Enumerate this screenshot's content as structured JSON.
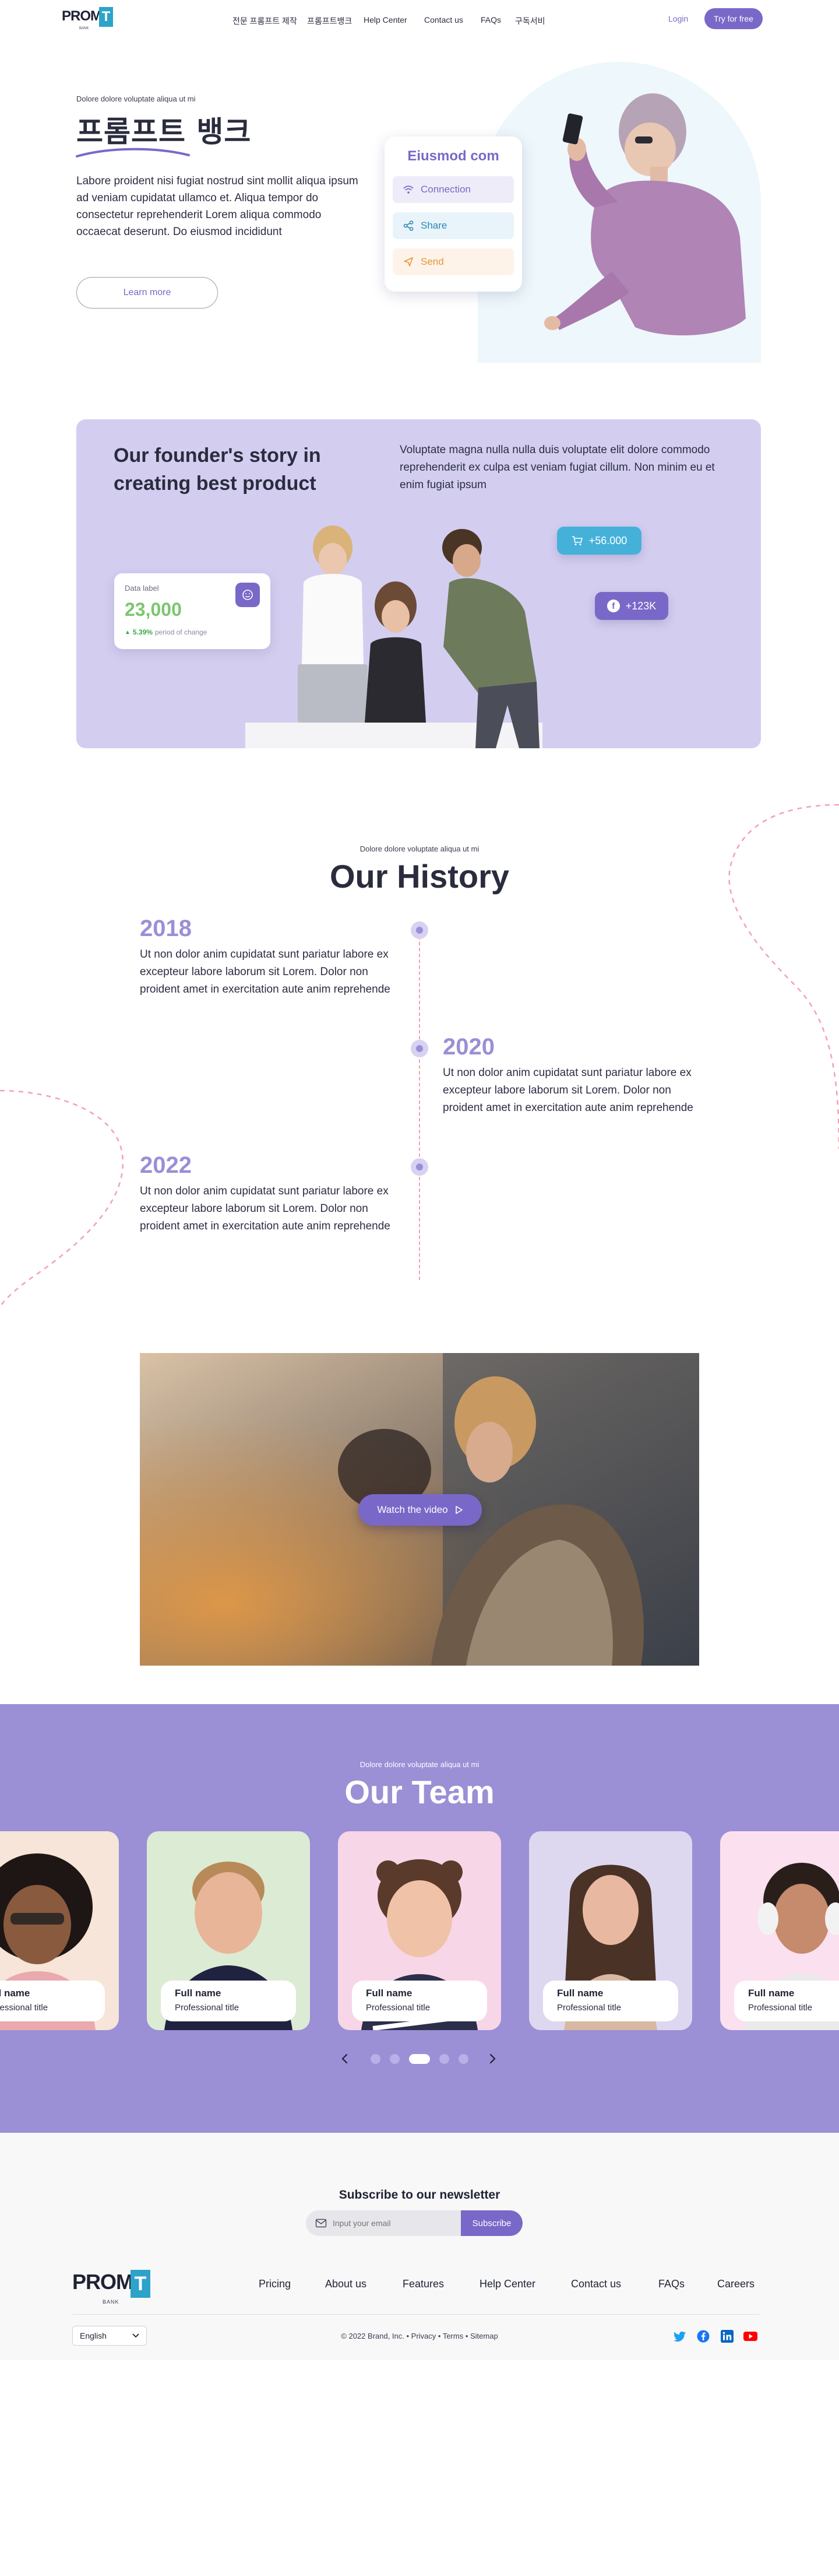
{
  "brand": {
    "name": "PROMP",
    "mark": "T",
    "tagline": "BANK"
  },
  "nav": {
    "links": [
      "전문 프롬프트 제작",
      "프롬프트뱅크",
      "Help Center",
      "Contact us",
      "FAQs",
      "구독서비"
    ],
    "login": "Login",
    "cta": "Try for free"
  },
  "hero": {
    "eyebrow": "Dolore dolore voluptate aliqua ut mi",
    "title": "프롬프트 뱅크",
    "body": "Labore proident nisi fugiat nostrud sint mollit aliqua ipsum ad veniam cupidatat ullamco et. Aliqua tempor do consectetur reprehenderit Lorem aliqua commodo occaecat deserunt. Do eiusmod incididunt",
    "button": "Learn more",
    "card": {
      "title": "Eiusmod com",
      "items": [
        {
          "label": "Connection",
          "icon": "wifi-icon",
          "color": "#7a68c8",
          "bg": "#eeecf8"
        },
        {
          "label": "Share",
          "icon": "share-icon",
          "color": "#2f86b8",
          "bg": "#e8f4f9"
        },
        {
          "label": "Send",
          "icon": "send-icon",
          "color": "#e8943a",
          "bg": "#fdf3e8"
        }
      ]
    }
  },
  "founder": {
    "title": "Our founder's story in creating best product",
    "body": "Voluptate magna nulla nulla duis voluptate elit dolore commodo reprehenderit ex culpa est veniam fugiat cillum. Non minim eu et enim fugiat ipsum",
    "stat": {
      "label": "Data label",
      "value": "23,000",
      "change": "5.39%",
      "change_text": "period of change"
    },
    "pill_cart": "+56.000",
    "pill_fb": "+123K",
    "colors": {
      "bg": "#d3cef0",
      "cart_pill": "#45b1d9",
      "fb_pill": "#7a68c8",
      "stat_green": "#7bc66f"
    }
  },
  "history": {
    "eyebrow": "Dolore dolore voluptate aliqua ut mi",
    "title": "Our History",
    "items": [
      {
        "year": "2018",
        "body": "Ut non dolor anim cupidatat sunt pariatur labore ex excepteur labore laborum sit Lorem. Dolor non proident amet in exercitation aute anim reprehende"
      },
      {
        "year": "2020",
        "body": "Ut non dolor anim cupidatat sunt pariatur labore ex excepteur labore laborum sit Lorem. Dolor non proident amet in exercitation aute anim reprehende"
      },
      {
        "year": "2022",
        "body": "Ut non dolor anim cupidatat sunt pariatur labore ex excepteur labore laborum sit Lorem. Dolor non proident amet in exercitation aute anim reprehende"
      }
    ]
  },
  "video": {
    "button": "Watch the video"
  },
  "team": {
    "eyebrow": "Dolore dolore voluptate aliqua ut mi",
    "title": "Our Team",
    "members": [
      {
        "name": "Full name",
        "title": "Professional title",
        "bg": "#f6e5d8"
      },
      {
        "name": "Full name",
        "title": "Professional title",
        "bg": "#dcebd4"
      },
      {
        "name": "Full name",
        "title": "Professional title",
        "bg": "#f7d6e8"
      },
      {
        "name": "Full name",
        "title": "Professional title",
        "bg": "#ddd8f0"
      },
      {
        "name": "Full name",
        "title": "Professional title",
        "bg": "#fbe0ef"
      }
    ],
    "active_page": 3,
    "pages": 5
  },
  "newsletter": {
    "title": "Subscribe to our newsletter",
    "placeholder": "Input your email",
    "button": "Subscribe"
  },
  "footer": {
    "links": [
      "Pricing",
      "About us",
      "Features",
      "Help Center",
      "Contact us",
      "FAQs",
      "Careers"
    ],
    "language": "English",
    "copyright": "© 2022 Brand, Inc. • Privacy • Terms • Sitemap",
    "social": [
      "twitter-icon",
      "facebook-icon",
      "linkedin-icon",
      "youtube-icon"
    ]
  },
  "accent": "#7a68c8"
}
